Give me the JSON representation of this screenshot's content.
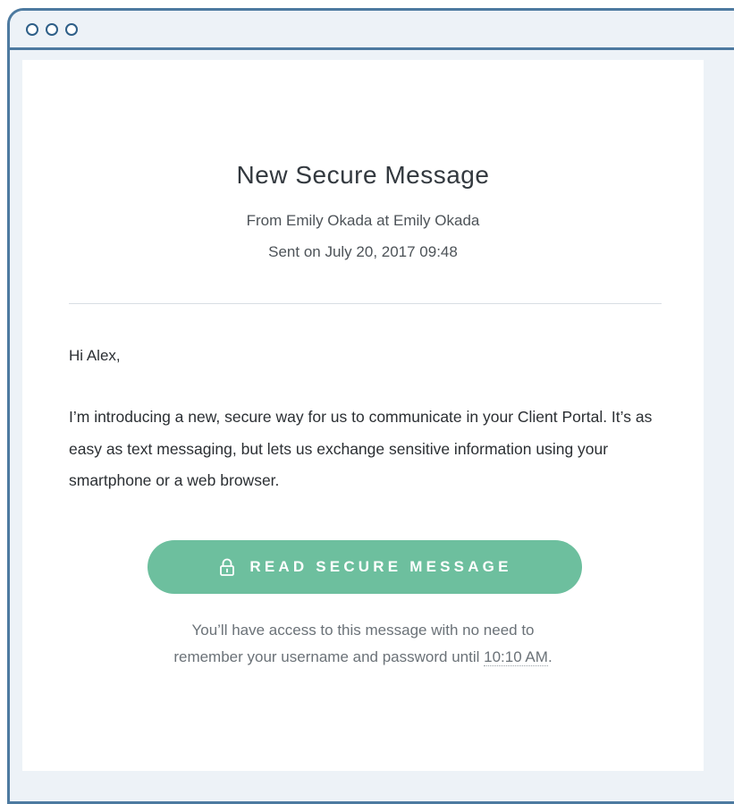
{
  "email": {
    "title": "New Secure Message",
    "from_line": "From Emily Okada at Emily Okada",
    "sent_line": "Sent on July 20, 2017 09:48",
    "greeting": "Hi Alex,",
    "body": "I’m introducing a new, secure way for us to communicate in your Client Portal. It’s as easy as text messaging, but lets us exchange sensitive information using your smartphone or a web browser.",
    "cta": {
      "label": "READ SECURE MESSAGE",
      "icon": "lock-icon",
      "color": "#6dbf9e"
    },
    "note_line1": "You’ll have access to this message with no need to",
    "note_line2_prefix": "remember your username and password until ",
    "note_time": "10:10 AM",
    "note_suffix": "."
  },
  "window": {
    "frame_color": "#4d7aa0",
    "controls": [
      "window-dot-icon",
      "window-dot-icon",
      "window-dot-icon"
    ]
  }
}
